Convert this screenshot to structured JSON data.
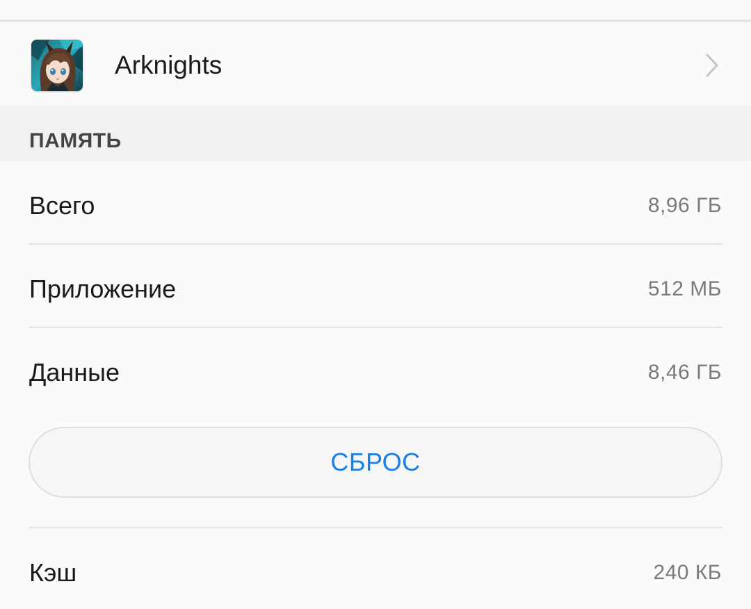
{
  "app": {
    "name": "Arknights",
    "icon": "arknights-app-icon"
  },
  "storage": {
    "section_title": "ПАМЯТЬ",
    "rows": [
      {
        "label": "Всего",
        "value": "8,96 ГБ"
      },
      {
        "label": "Приложение",
        "value": "512 МБ"
      },
      {
        "label": "Данные",
        "value": "8,46 ГБ"
      }
    ],
    "reset_label": "СБРОС",
    "cache": {
      "label": "Кэш",
      "value": "240 КБ"
    }
  },
  "colors": {
    "accent": "#1a7fe6",
    "background": "#fafafa",
    "section_bg": "#f1f1f1"
  }
}
